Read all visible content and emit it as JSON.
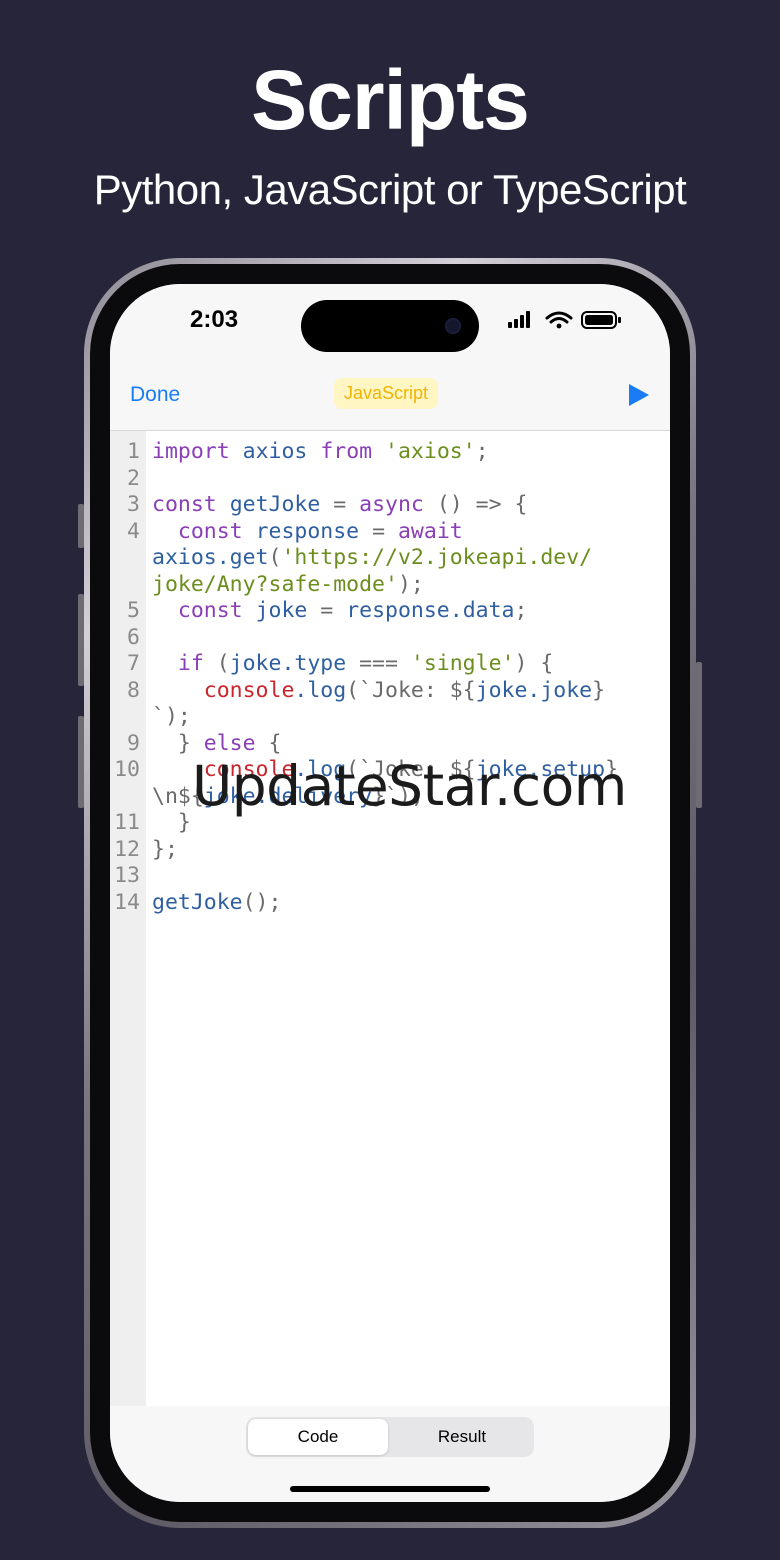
{
  "promo": {
    "headline": "Scripts",
    "subheadline": "Python, JavaScript or TypeScript"
  },
  "status_bar": {
    "time": "2:03"
  },
  "nav": {
    "done_label": "Done",
    "language_label": "JavaScript",
    "run_icon": "play-icon"
  },
  "editor": {
    "lines": [
      {
        "n": "1",
        "tokens": [
          [
            "kw",
            "import"
          ],
          [
            "pn",
            " "
          ],
          [
            "id",
            "axios"
          ],
          [
            "pn",
            " "
          ],
          [
            "kw",
            "from"
          ],
          [
            "pn",
            " "
          ],
          [
            "str",
            "'axios'"
          ],
          [
            "pn",
            ";"
          ]
        ]
      },
      {
        "n": "2",
        "tokens": []
      },
      {
        "n": "3",
        "tokens": [
          [
            "kw",
            "const"
          ],
          [
            "pn",
            " "
          ],
          [
            "id",
            "getJoke"
          ],
          [
            "pn",
            " = "
          ],
          [
            "kw",
            "async"
          ],
          [
            "pn",
            " () => {"
          ]
        ]
      },
      {
        "n": "4",
        "tokens": [
          [
            "pn",
            "  "
          ],
          [
            "kw",
            "const"
          ],
          [
            "pn",
            " "
          ],
          [
            "id",
            "response"
          ],
          [
            "pn",
            " = "
          ],
          [
            "kw",
            "await"
          ]
        ]
      },
      {
        "n": "",
        "tokens": [
          [
            "id",
            "axios.get"
          ],
          [
            "pn",
            "("
          ],
          [
            "str",
            "'https://v2.jokeapi.dev/"
          ]
        ]
      },
      {
        "n": "",
        "tokens": [
          [
            "str",
            "joke/Any?safe-mode'"
          ],
          [
            "pn",
            ");"
          ]
        ]
      },
      {
        "n": "5",
        "tokens": [
          [
            "pn",
            "  "
          ],
          [
            "kw",
            "const"
          ],
          [
            "pn",
            " "
          ],
          [
            "id",
            "joke"
          ],
          [
            "pn",
            " = "
          ],
          [
            "id",
            "response.data"
          ],
          [
            "pn",
            ";"
          ]
        ]
      },
      {
        "n": "6",
        "tokens": []
      },
      {
        "n": "7",
        "tokens": [
          [
            "pn",
            "  "
          ],
          [
            "kw",
            "if"
          ],
          [
            "pn",
            " ("
          ],
          [
            "id",
            "joke.type"
          ],
          [
            "pn",
            " === "
          ],
          [
            "str",
            "'single'"
          ],
          [
            "pn",
            ") {"
          ]
        ]
      },
      {
        "n": "8",
        "tokens": [
          [
            "pn",
            "    "
          ],
          [
            "obj",
            "console"
          ],
          [
            "id",
            ".log"
          ],
          [
            "pn",
            "(`Joke: ${"
          ],
          [
            "id",
            "joke.joke"
          ],
          [
            "pn",
            "}"
          ]
        ]
      },
      {
        "n": "",
        "tokens": [
          [
            "pn",
            "`);"
          ]
        ]
      },
      {
        "n": "9",
        "tokens": [
          [
            "pn",
            "  } "
          ],
          [
            "kw",
            "else"
          ],
          [
            "pn",
            " {"
          ]
        ]
      },
      {
        "n": "10",
        "tokens": [
          [
            "pn",
            "    "
          ],
          [
            "obj",
            "console"
          ],
          [
            "id",
            ".log"
          ],
          [
            "pn",
            "(`Joke: ${"
          ],
          [
            "id",
            "joke.setup"
          ],
          [
            "pn",
            "}"
          ]
        ]
      },
      {
        "n": "",
        "tokens": [
          [
            "pn",
            "\\n${"
          ],
          [
            "id",
            "joke.delivery"
          ],
          [
            "pn",
            "}`);"
          ]
        ]
      },
      {
        "n": "11",
        "tokens": [
          [
            "pn",
            "  }"
          ]
        ]
      },
      {
        "n": "12",
        "tokens": [
          [
            "pn",
            "};"
          ]
        ]
      },
      {
        "n": "13",
        "tokens": []
      },
      {
        "n": "14",
        "tokens": [
          [
            "id",
            "getJoke"
          ],
          [
            "pn",
            "();"
          ]
        ]
      }
    ]
  },
  "watermark": "UpdateStar.com",
  "tabs": {
    "code_label": "Code",
    "result_label": "Result",
    "selected": "Code"
  },
  "colors": {
    "background": "#26253a",
    "accent": "#1a7cf5",
    "language_badge_text": "#f2b400",
    "language_badge_bg": "#fff6c4"
  }
}
